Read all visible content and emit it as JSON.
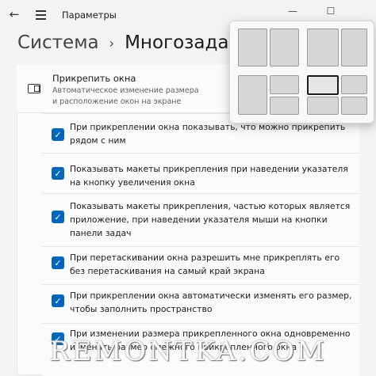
{
  "app": {
    "title": "Параметры"
  },
  "window_controls": {
    "minimize": "—",
    "maximize": "☐"
  },
  "breadcrumb": {
    "parent": "Система",
    "separator": "›",
    "current": "Многозадачность"
  },
  "snap_section": {
    "title": "Прикрепить окна",
    "subtitle": "Автоматическое изменение размера и расположение окон на экране"
  },
  "options": [
    {
      "checked": true,
      "label": "При прикреплении окна показывать, что можно прикрепить рядом с ним"
    },
    {
      "checked": true,
      "label": "Показывать макеты прикрепления при наведении указателя на кнопку увеличения окна"
    },
    {
      "checked": true,
      "label": "Показывать макеты прикрепления, частью которых является приложение, при наведении указателя мыши на кнопки панели задач"
    },
    {
      "checked": true,
      "label": "При перетаскивании окна разрешить мне прикреплять его без перетаскивания на самый край экрана"
    },
    {
      "checked": true,
      "label": "При прикреплении окна автоматически изменять его размер, чтобы заполнить пространство"
    },
    {
      "checked": true,
      "label": "При изменении размера прикрепленного окна одновременно изменять размер смежного прикрепленного окна"
    }
  ],
  "snap_layouts_popup": {
    "layouts": 4,
    "selected_layout": 4,
    "selected_zone": 1
  },
  "watermark": "REMONTKA.COM",
  "colors": {
    "accent": "#0067c0",
    "background": "#f3f3f3",
    "card": "#fbfbfb"
  },
  "icons": {
    "back": "arrow-left-icon",
    "menu": "hamburger-menu-icon",
    "snap": "snap-window-icon",
    "check": "checkmark-icon"
  }
}
